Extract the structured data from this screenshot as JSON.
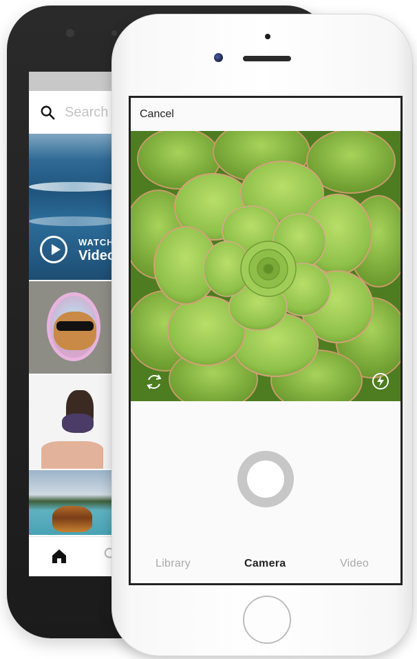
{
  "back_phone": {
    "search": {
      "placeholder": "Search"
    },
    "featured": {
      "watch_label": "WATCH",
      "video_label": "Video"
    },
    "tab_icons": [
      "home-icon",
      "search-icon"
    ]
  },
  "front_phone": {
    "header": {
      "cancel_label": "Cancel"
    },
    "controls": {
      "flip_icon": "flip-camera-icon",
      "flash_icon": "flash-icon"
    },
    "modes": [
      {
        "label": "Library",
        "selected": false
      },
      {
        "label": "Camera",
        "selected": true
      },
      {
        "label": "Video",
        "selected": false
      }
    ]
  },
  "colors": {
    "accent_text": "#222222",
    "inactive_text": "#a9a9a9",
    "shutter_ring": "#c7c7c7",
    "placeholder": "#c3c3c3"
  }
}
